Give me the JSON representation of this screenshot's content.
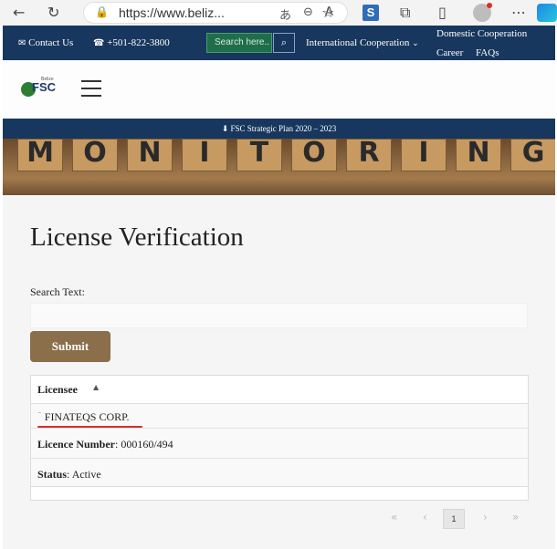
{
  "browser": {
    "url": "https://www.beliz...",
    "icons": [
      "back-icon",
      "refresh-icon",
      "lock-icon",
      "read-aloud-icon",
      "zoom-out-icon",
      "text-size-icon",
      "favorite-icon",
      "extension-icon",
      "puzzle-icon",
      "split-screen-icon",
      "profile-icon",
      "more-icon",
      "edge-icon"
    ]
  },
  "topbar": {
    "contact": "Contact Us",
    "phone": "+501-822-3800",
    "search_placeholder": "Search here..",
    "intl": "International Cooperation",
    "domestic": "Domestic Cooperation",
    "career": "Career",
    "faqs": "FAQs"
  },
  "header": {
    "logo_small": "Belize",
    "logo_text": "FSC"
  },
  "strategic": {
    "label": "FSC Strategic Plan 2020 – 2023"
  },
  "banner": {
    "letters": [
      "M",
      "O",
      "N",
      "I",
      "T",
      "O",
      "R",
      "I",
      "N",
      "G"
    ]
  },
  "main": {
    "title": "License Verification",
    "search_label": "Search Text:",
    "submit": "Submit",
    "table": {
      "header": "Licensee",
      "licensee": "FINATEQS CORP.",
      "licence_number_label": "Licence Number",
      "licence_number": ": 000160/494",
      "status_label": "Status",
      "status": ": Active"
    },
    "pager": {
      "first": "«",
      "prev": "‹",
      "current": "1",
      "next": "›",
      "last": "»"
    }
  },
  "colors": {
    "navy": "#17375e",
    "accent_brown": "#8b6e4a",
    "underline_red": "#d32f2f"
  }
}
